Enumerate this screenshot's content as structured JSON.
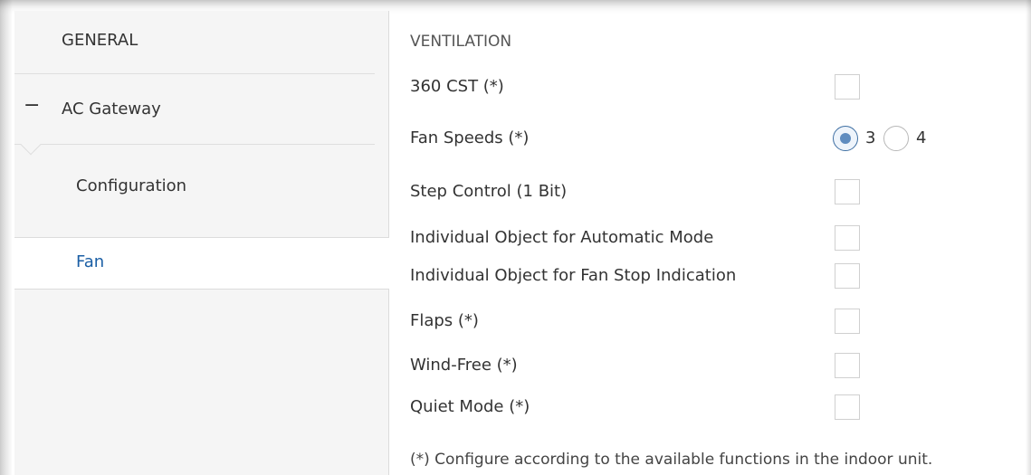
{
  "sidebar": {
    "general_label": "GENERAL",
    "ac_gateway": {
      "collapse_symbol": "−",
      "label": "AC Gateway"
    },
    "configuration_label": "Configuration",
    "fan_label": "Fan"
  },
  "main": {
    "section_title": "VENTILATION",
    "options": [
      {
        "label": "360 CST (*)",
        "checked": false
      },
      {
        "label": "Fan Speeds (*)"
      },
      {
        "label": "Step Control (1 Bit)",
        "checked": false
      },
      {
        "label": "Individual Object for Automatic Mode",
        "checked": false
      },
      {
        "label": "Individual Object for Fan Stop Indication",
        "checked": false
      },
      {
        "label": "Flaps (*)",
        "checked": false
      },
      {
        "label": "Wind-Free (*)",
        "checked": false
      },
      {
        "label": "Quiet Mode (*)",
        "checked": false
      }
    ],
    "fan_speeds": {
      "options": [
        "3",
        "4"
      ],
      "selected": "3"
    },
    "footnote": "(*) Configure according to the available functions in the indoor unit."
  },
  "colors": {
    "sidebar_bg": "#f5f5f5",
    "selected_item_text": "#1b5fa5",
    "radio_selected": "#5f8cbf"
  }
}
